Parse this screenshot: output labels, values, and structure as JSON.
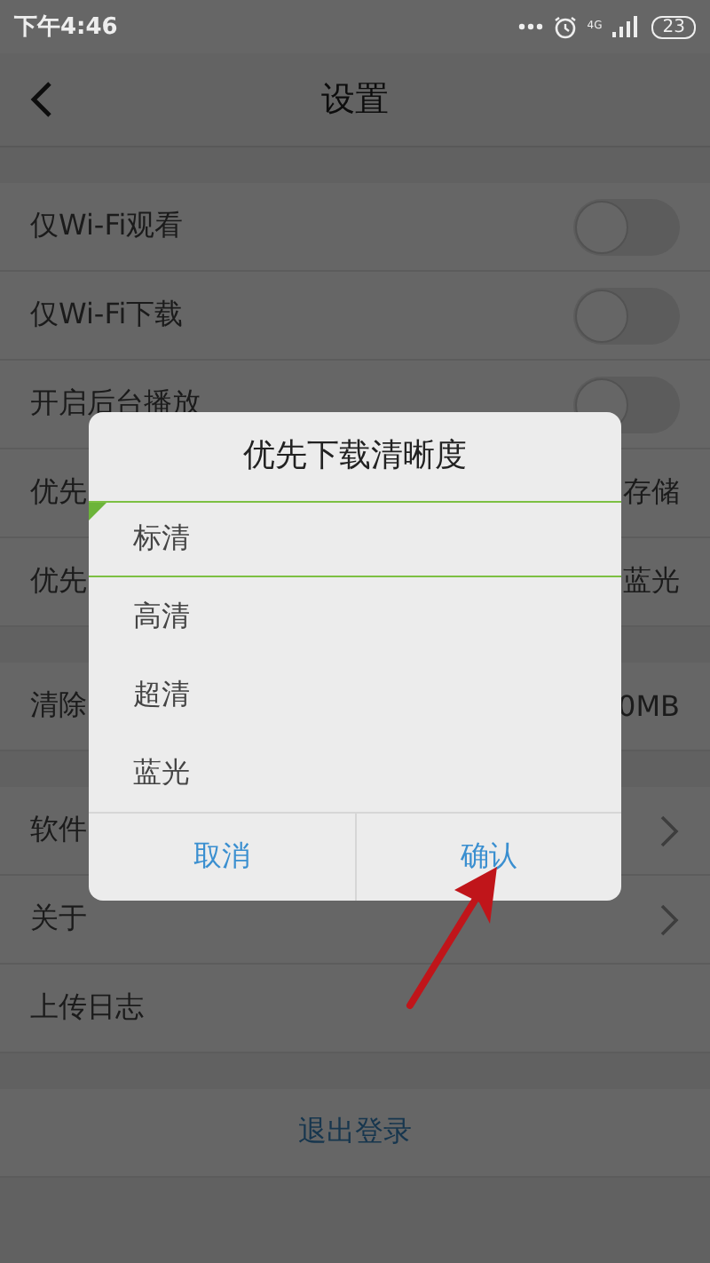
{
  "status_bar": {
    "time": "下午4:46",
    "network": "4G",
    "battery": "23"
  },
  "header": {
    "title": "设置"
  },
  "sections": [
    {
      "rows": [
        {
          "kind": "toggle",
          "label": "仅Wi-Fi观看",
          "on": false
        },
        {
          "kind": "toggle",
          "label": "仅Wi-Fi下载",
          "on": false
        },
        {
          "kind": "toggle",
          "label": "开启后台播放",
          "on": false
        },
        {
          "kind": "value",
          "label": "优先",
          "value": "存储"
        },
        {
          "kind": "value",
          "label": "优先",
          "value": "蓝光"
        }
      ]
    },
    {
      "rows": [
        {
          "kind": "value",
          "label": "清除",
          "value": "0MB"
        }
      ]
    },
    {
      "rows": [
        {
          "kind": "link",
          "label": "软件"
        },
        {
          "kind": "link",
          "label": "关于"
        },
        {
          "kind": "plain",
          "label": "上传日志"
        }
      ]
    },
    {
      "rows": [
        {
          "kind": "action",
          "label": "退出登录"
        }
      ]
    }
  ],
  "dialog": {
    "title": "优先下载清晰度",
    "options": [
      {
        "label": "标清",
        "selected": true
      },
      {
        "label": "高清",
        "selected": false
      },
      {
        "label": "超清",
        "selected": false
      },
      {
        "label": "蓝光",
        "selected": false
      }
    ],
    "buttons": [
      {
        "label": "取消"
      },
      {
        "label": "确认"
      }
    ]
  },
  "annotation": {
    "kind": "arrow"
  }
}
